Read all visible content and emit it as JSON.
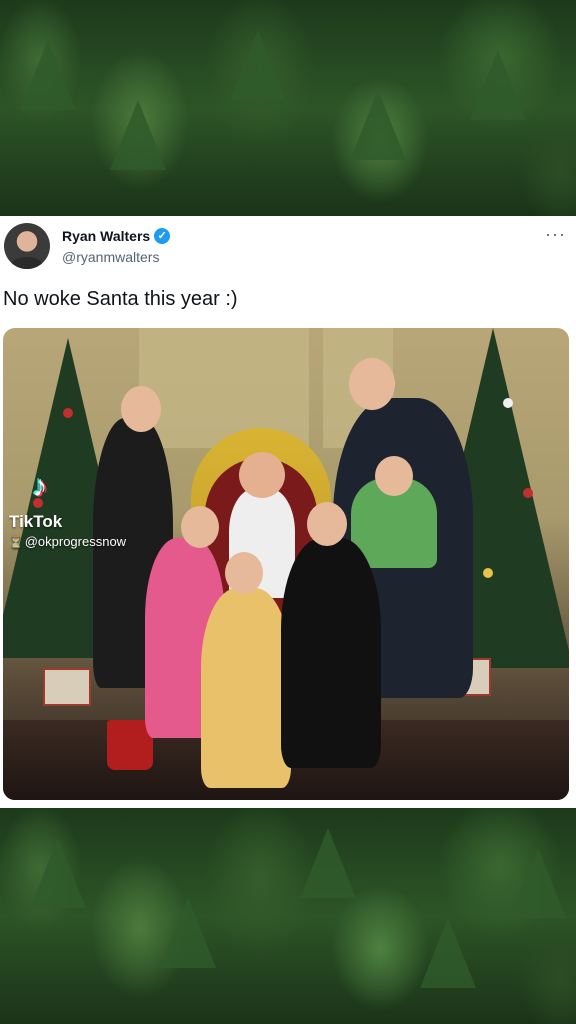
{
  "tweet": {
    "author_name": "Ryan Walters",
    "author_handle": "@ryanmwalters",
    "verified_icon": "verified-badge-icon",
    "more_icon": "more-options-icon",
    "text": "No woke Santa this year :)"
  },
  "photo": {
    "watermark_app": "TikTok",
    "watermark_user": "@okprogressnow"
  },
  "colors": {
    "verified": "#1d9bf0",
    "text": "#0f1419",
    "secondary_text": "#536471",
    "card_background": "#ffffff",
    "forest": "#2d5427"
  }
}
